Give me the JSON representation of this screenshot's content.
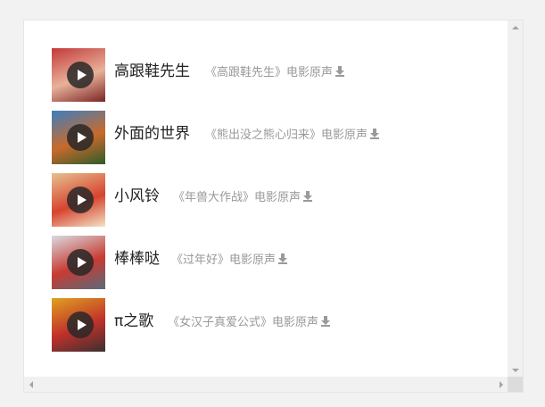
{
  "songs": [
    {
      "title": "高跟鞋先生",
      "source": "《高跟鞋先生》电影原声",
      "thumb_icon": "movie-poster-thumbnail",
      "colors": [
        "#c23a3a",
        "#e8b29a",
        "#7a2424"
      ]
    },
    {
      "title": "外面的世界",
      "source": "《熊出没之熊心归来》电影原声",
      "thumb_icon": "movie-poster-thumbnail",
      "colors": [
        "#3c7fc0",
        "#c96a2b",
        "#2e5b2a"
      ]
    },
    {
      "title": "小风铃",
      "source": "《年兽大作战》电影原声",
      "thumb_icon": "movie-poster-thumbnail",
      "colors": [
        "#e7c190",
        "#d7442f",
        "#f3e3c6"
      ]
    },
    {
      "title": "棒棒哒",
      "source": "《过年好》电影原声",
      "thumb_icon": "movie-poster-thumbnail",
      "colors": [
        "#d9dbe0",
        "#c83b32",
        "#5a6a7a"
      ]
    },
    {
      "title": "π之歌",
      "source": "《女汉子真爱公式》电影原声",
      "thumb_icon": "movie-poster-thumbnail",
      "colors": [
        "#e0a020",
        "#c0302a",
        "#3a3030"
      ]
    }
  ],
  "icons": {
    "play": "play-icon",
    "download": "download-icon"
  }
}
